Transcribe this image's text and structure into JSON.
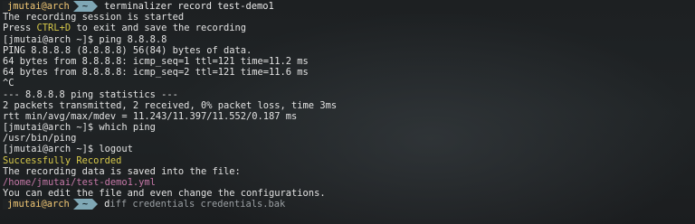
{
  "prompt": {
    "user_host": "jmutai@arch",
    "path": "~"
  },
  "lines": {
    "cmd1": "terminalizer record test-demo1",
    "l1": "The recording session is started",
    "l2_a": "Press ",
    "l2_key": "CTRL+D",
    "l2_b": " to exit and save the recording",
    "l3": "[jmutai@arch ~]$ ping 8.8.8.8",
    "l4": "PING 8.8.8.8 (8.8.8.8) 56(84) bytes of data.",
    "l5": "64 bytes from 8.8.8.8: icmp_seq=1 ttl=121 time=11.2 ms",
    "l6": "64 bytes from 8.8.8.8: icmp_seq=2 ttl=121 time=11.6 ms",
    "l7": "^C",
    "l8": "--- 8.8.8.8 ping statistics ---",
    "l9": "2 packets transmitted, 2 received, 0% packet loss, time 3ms",
    "l10": "rtt min/avg/max/mdev = 11.243/11.397/11.552/0.187 ms",
    "l11": "[jmutai@arch ~]$ which ping",
    "l12": "/usr/bin/ping",
    "l13": "[jmutai@arch ~]$ logout",
    "l14": "Successfully Recorded",
    "l15": "The recording data is saved into the file:",
    "l16": "/home/jmutai/test-demo1.yml",
    "l17": "You can edit the file and even change the configurations.",
    "cmd2_first": "d",
    "cmd2_rest": "iff credentials credentials.bak"
  },
  "colors": {
    "background": "#1b1d1f",
    "text": "#e2e2e2",
    "accent_yellow": "#d7c94a",
    "accent_magenta": "#c678a8",
    "prompt_path_bg": "#7fa7b5",
    "prompt_user": "#f0c674"
  }
}
